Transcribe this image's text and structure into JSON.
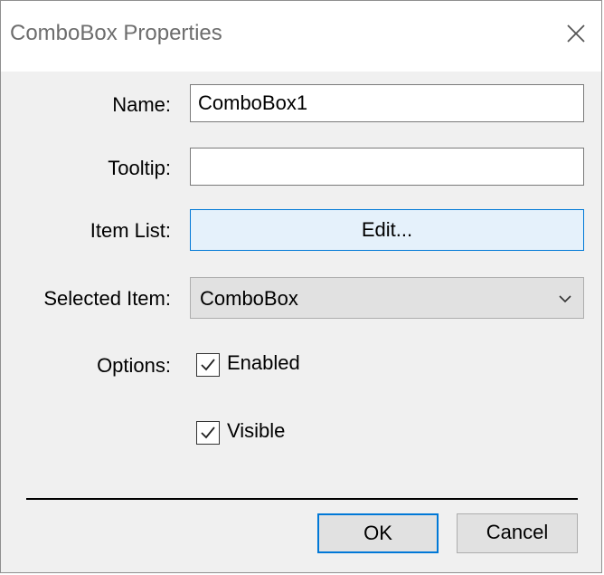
{
  "window": {
    "title": "ComboBox Properties",
    "close_icon": "close-icon"
  },
  "form": {
    "name_label": "Name:",
    "name_value": "ComboBox1",
    "tooltip_label": "Tooltip:",
    "tooltip_value": "",
    "item_list_label": "Item List:",
    "item_list_button": "Edit...",
    "selected_item_label": "Selected Item:",
    "selected_item_value": "ComboBox",
    "options_label": "Options:",
    "options": [
      {
        "label": "Enabled",
        "checked": true
      },
      {
        "label": "Visible",
        "checked": true
      }
    ]
  },
  "buttons": {
    "ok": "OK",
    "cancel": "Cancel"
  },
  "colors": {
    "accent": "#0078d7",
    "button_hover_bg": "#e5f1fb",
    "dialog_bg": "#f0f0f0"
  }
}
